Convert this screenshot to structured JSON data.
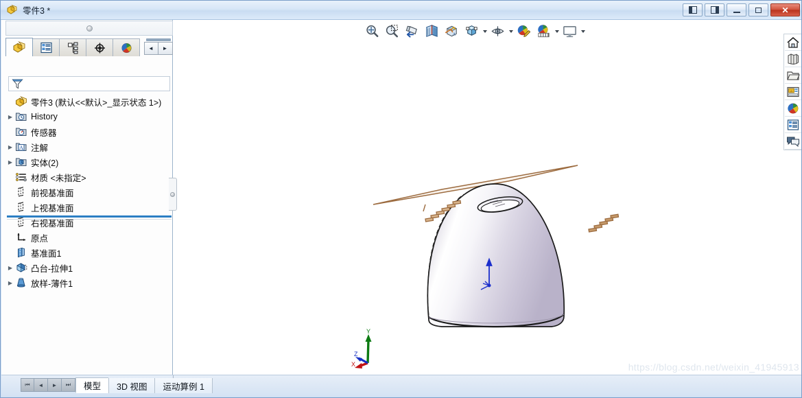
{
  "window": {
    "title": "零件3 *",
    "app_icon": "solidworks-part-icon",
    "controls": [
      {
        "name": "restore-left-panel",
        "glyph": "panel-left"
      },
      {
        "name": "restore-right-panel",
        "glyph": "panel-right"
      },
      {
        "name": "minimize",
        "glyph": "minimize"
      },
      {
        "name": "maximize",
        "glyph": "maximize"
      },
      {
        "name": "close",
        "glyph": "close",
        "label": "✕"
      }
    ]
  },
  "feature_manager": {
    "tabs": [
      {
        "name": "feature-manager-design-tree",
        "icon": "part-yellow-icon",
        "active": true
      },
      {
        "name": "property-manager",
        "icon": "property-list-icon",
        "active": false
      },
      {
        "name": "configuration-manager",
        "icon": "configuration-icon",
        "active": false
      },
      {
        "name": "dimxpert-manager",
        "icon": "dimxpert-target-icon",
        "active": false
      },
      {
        "name": "display-manager",
        "icon": "display-sphere-icon",
        "active": false
      }
    ],
    "nav": {
      "prev": "◄",
      "next": "►"
    },
    "filter": {
      "placeholder": "",
      "value": "",
      "icon": "filter-funnel-icon"
    },
    "tree": [
      {
        "label": "零件3  (默认<<默认>_显示状态 1>)",
        "icon": "part-yellow-icon",
        "indent": 0,
        "expandable": false,
        "root": true
      },
      {
        "label": "History",
        "icon": "history-folder-icon",
        "indent": 1,
        "expandable": true
      },
      {
        "label": "传感器",
        "icon": "sensor-folder-icon",
        "indent": 1,
        "expandable": false
      },
      {
        "label": "注解",
        "icon": "annotation-folder-icon",
        "indent": 1,
        "expandable": true
      },
      {
        "label": "实体(2)",
        "icon": "solid-bodies-folder-icon",
        "indent": 1,
        "expandable": true
      },
      {
        "label": "材质 <未指定>",
        "icon": "material-icon",
        "indent": 1,
        "expandable": false
      },
      {
        "label": "前视基准面",
        "icon": "plane-icon",
        "indent": 1,
        "expandable": false
      },
      {
        "label": "上视基准面",
        "icon": "plane-icon",
        "indent": 1,
        "expandable": false
      },
      {
        "label": "右视基准面",
        "icon": "plane-icon",
        "indent": 1,
        "expandable": false
      },
      {
        "label": "原点",
        "icon": "origin-icon",
        "indent": 1,
        "expandable": false
      },
      {
        "label": "基准面1",
        "icon": "reference-plane-icon",
        "indent": 1,
        "expandable": false
      },
      {
        "label": "凸台-拉伸1",
        "icon": "boss-extrude-icon",
        "indent": 1,
        "expandable": true
      },
      {
        "label": "放样-薄件1",
        "icon": "loft-thin-icon",
        "indent": 1,
        "expandable": true
      }
    ]
  },
  "viewport_toolbar": [
    {
      "name": "zoom-to-fit-button",
      "icon": "zoom-to-fit-icon",
      "caret": false
    },
    {
      "name": "zoom-to-area-button",
      "icon": "zoom-to-area-icon",
      "caret": false
    },
    {
      "name": "previous-view-button",
      "icon": "previous-view-icon",
      "caret": false
    },
    {
      "name": "section-view-button",
      "icon": "section-view-icon",
      "caret": false
    },
    {
      "name": "view-orientation-button",
      "icon": "view-orientation-icon",
      "caret": false
    },
    {
      "name": "display-style-button",
      "icon": "display-style-cube-icon",
      "caret": true
    },
    {
      "name": "hide-show-items-button",
      "icon": "hide-show-eye-icon",
      "caret": true
    },
    {
      "name": "edit-appearance-button",
      "icon": "edit-appearance-icon",
      "caret": false
    },
    {
      "name": "apply-scene-button",
      "icon": "apply-scene-icon",
      "caret": true
    },
    {
      "name": "view-settings-button",
      "icon": "view-settings-monitor-icon",
      "caret": true
    }
  ],
  "right_toolbar": [
    {
      "name": "task-pane-home-button",
      "icon": "home-icon"
    },
    {
      "name": "design-library-button",
      "icon": "design-library-icon"
    },
    {
      "name": "file-explorer-button",
      "icon": "file-folder-icon"
    },
    {
      "name": "view-palette-button",
      "icon": "view-palette-icon"
    },
    {
      "name": "appearances-scenes-button",
      "icon": "appearances-sphere-icon"
    },
    {
      "name": "custom-properties-button",
      "icon": "custom-properties-icon"
    },
    {
      "name": "solidworks-forum-button",
      "icon": "forum-bubble-icon"
    }
  ],
  "model": {
    "triad": {
      "x_label": "X",
      "y_label": "Y",
      "z_label": "Z"
    },
    "origin_triad_visible": true,
    "body_color": "#d8d4e0",
    "plane_edge_color": "#9c6b3f",
    "plane_fill_color": "#f7f0e8"
  },
  "bottom_tabs": {
    "nav": [
      "⏮",
      "◄",
      "►",
      "⏭"
    ],
    "tabs": [
      {
        "label": "模型",
        "active": true
      },
      {
        "label": "3D 视图",
        "active": false
      },
      {
        "label": "运动算例 1",
        "active": false
      }
    ]
  },
  "watermark": "https://blog.csdn.net/weixin_41945913"
}
